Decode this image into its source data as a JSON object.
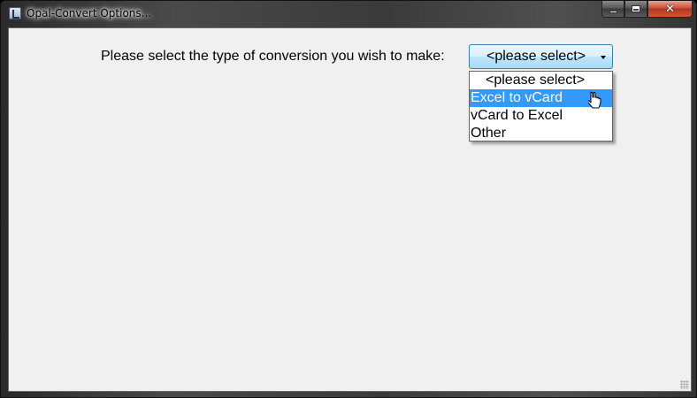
{
  "window": {
    "title": "Opal-Convert Options...",
    "icon": "app-icon",
    "buttons": {
      "minimize": "minimize-icon",
      "maximize": "maximize-icon",
      "close": "close-icon"
    }
  },
  "form": {
    "prompt": "Please select the type of conversion you wish to make:",
    "select": {
      "value": "<please select>",
      "expanded": true,
      "options": [
        "<please select>",
        "Excel to vCard",
        "vCard to Excel",
        "Other"
      ],
      "highlighted": "Excel to vCard"
    }
  },
  "colors": {
    "highlight": "#3399ff",
    "client_background": "#f0f0f0"
  }
}
